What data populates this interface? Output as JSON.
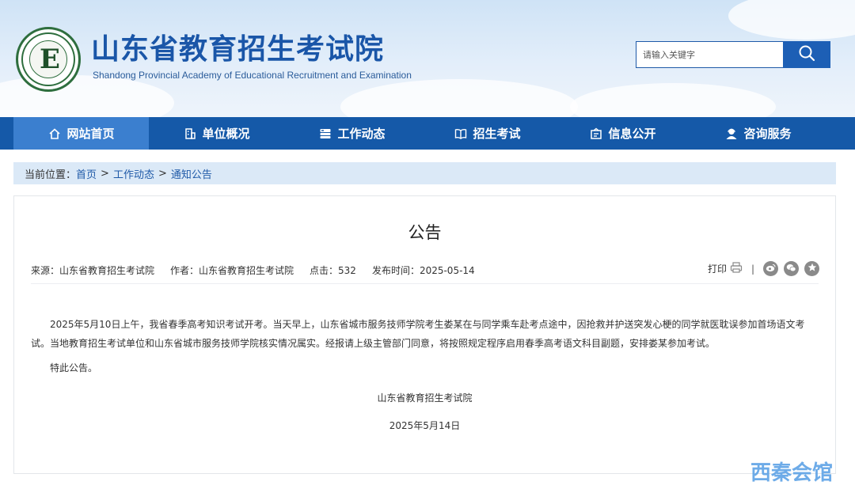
{
  "header": {
    "title": "山东省教育招生考试院",
    "subtitle": "Shandong Provincial Academy of Educational Recruitment and Examination",
    "logo_ring_text": "Shandong Educational Admission & Examination",
    "search_placeholder": "请输入关键字"
  },
  "nav": {
    "items": [
      {
        "label": "网站首页",
        "icon": "home-icon"
      },
      {
        "label": "单位概况",
        "icon": "building-icon"
      },
      {
        "label": "工作动态",
        "icon": "server-icon"
      },
      {
        "label": "招生考试",
        "icon": "book-icon"
      },
      {
        "label": "信息公开",
        "icon": "notice-icon"
      },
      {
        "label": "咨询服务",
        "icon": "user-service-icon"
      }
    ],
    "active_index": 0
  },
  "breadcrumb": {
    "prefix": "当前位置：",
    "items": [
      "首页",
      "工作动态",
      "通知公告"
    ],
    "separator": ">"
  },
  "article": {
    "title": "公告",
    "meta": {
      "source": "来源：山东省教育招生考试院",
      "author": "作者：山东省教育招生考试院",
      "clicks": "点击：532",
      "date": "发布时间：2025-05-14"
    },
    "print_label": "打印",
    "tools_separator": "|",
    "paragraphs": [
      "2025年5月10日上午，我省春季高考知识考试开考。当天早上，山东省城市服务技师学院考生娄某在与同学乘车赴考点途中，因抢救并护送突发心梗的同学就医耽误参加首场语文考试。当地教育招生考试单位和山东省城市服务技师学院核实情况属实。经报请上级主管部门同意，将按照规定程序启用春季高考语文科目副题，安排娄某参加考试。",
      "特此公告。"
    ],
    "signature": "山东省教育招生考试院",
    "sign_date": "2025年5月14日"
  },
  "watermark": "西秦会馆",
  "colors": {
    "nav_bg": "#1559a8",
    "nav_active": "#3b7fcf",
    "breadcrumb_bg": "#dbe9f7",
    "link": "#1f5aa8",
    "title_blue": "#1a56a8"
  }
}
